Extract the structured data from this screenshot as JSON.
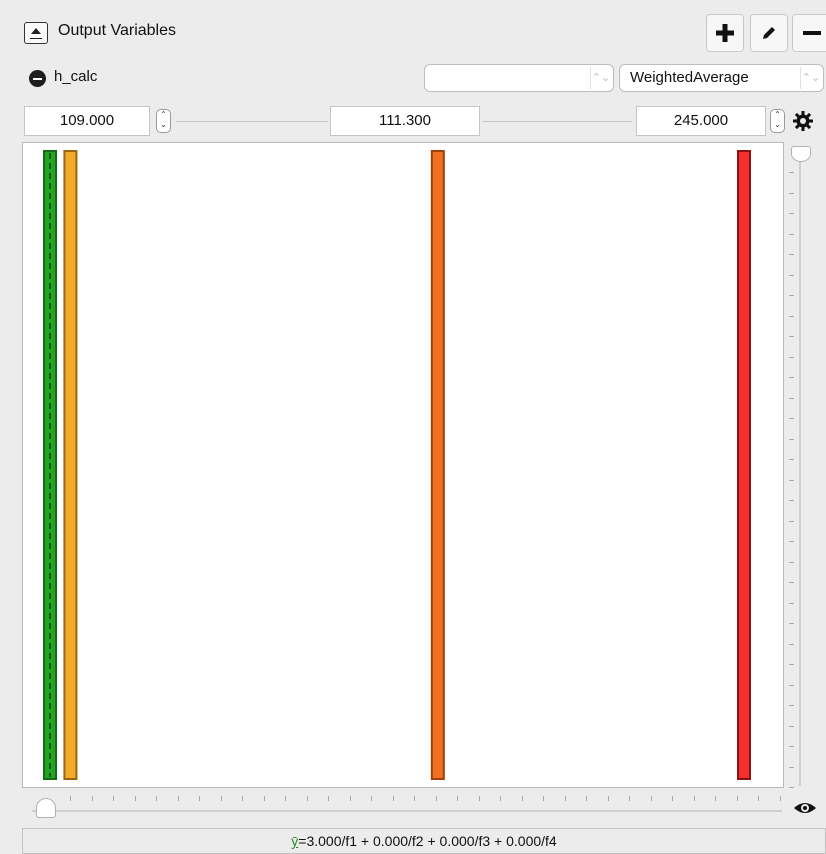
{
  "panel": {
    "title": "Output Variables",
    "icons": {
      "collapse": "collapse-panel-icon",
      "add": "plus-icon",
      "edit": "pencil-icon",
      "remove": "minus-icon"
    }
  },
  "variable": {
    "name": "h_calc",
    "first_select_value": "",
    "method_select_value": "WeightedAverage"
  },
  "range": {
    "min": "109.000",
    "mid": "111.300",
    "max": "245.000"
  },
  "terms": [
    {
      "name": "f1",
      "color": "#22a522",
      "border": "#166b16",
      "value": 109.0,
      "dashed_center": true
    },
    {
      "name": "f2",
      "color": "#f2ab2b",
      "border": "#9a6610",
      "value": 113.0
    },
    {
      "name": "f3",
      "color": "#f26f22",
      "border": "#a1400a",
      "value": 185.0
    },
    {
      "name": "f4",
      "color": "#f23030",
      "border": "#8c1010",
      "value": 245.0
    }
  ],
  "formula": {
    "ybar": "ȳ",
    "text": "=3.000/f1 + 0.000/f2 + 0.000/f3 + 0.000/f4"
  },
  "controls": {
    "visibility_icon": "eye-icon",
    "settings_icon": "gear-icon"
  }
}
